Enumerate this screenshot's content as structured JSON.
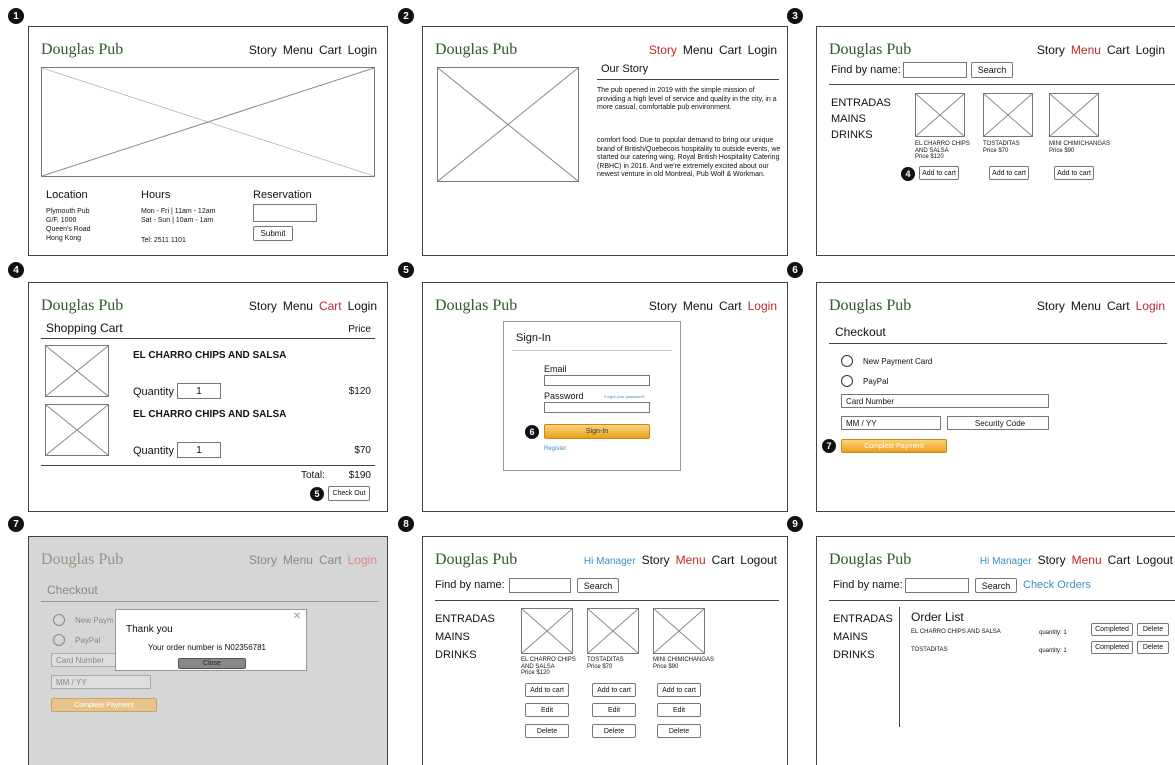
{
  "brand": "Douglas Pub",
  "nav": {
    "story": "Story",
    "menu": "Menu",
    "cart": "Cart",
    "login": "Login",
    "logout": "Logout",
    "hi": "Hi Manager"
  },
  "step_numbers": [
    "1",
    "2",
    "3",
    "4",
    "5",
    "6",
    "7",
    "8",
    "9"
  ],
  "home": {
    "location_title": "Location",
    "location_lines": [
      "Plymouth Pub",
      "G/F, 1000",
      "Queen's Road",
      "Hong Kong"
    ],
    "hours_title": "Hours",
    "hours_lines": [
      "Mon - Fri | 11am - 12am",
      "Sat - Sun | 10am - 1am"
    ],
    "tel": "Tel: 2511 1101",
    "reservation_title": "Reservation",
    "submit_label": "Submit"
  },
  "story": {
    "title": "Our Story",
    "paragraph1": "The pub opened in 2019 with the simple mission of providing a high level of service and quality in the city, in a more casual, comfortable pub environment.",
    "paragraph2": "comfort food. Due to popular demand to bring our unique brand of British/Quebecois hospitality to outside events, we started our catering wing, Royal British Hospitality Catering (RBHC) in 2016. And we're extremely excited about our newest venture in old Montreal, Pub Wolf & Workman."
  },
  "menu": {
    "find_label": "Find by name:",
    "search_label": "Search",
    "check_orders": "Check Orders",
    "categories": [
      "ENTRADAS",
      "MAINS",
      "DRINKS"
    ],
    "items": [
      {
        "name": "EL CHARRO CHIPS AND SALSA",
        "price": "Price $120"
      },
      {
        "name": "TOSTADITAS",
        "price": "Price $70"
      },
      {
        "name": "MINI CHIMICHANGAS",
        "price": "Price $90"
      }
    ],
    "add_to_cart": "Add to cart",
    "edit": "Edit",
    "delete": "Delete",
    "callout": "4"
  },
  "cart": {
    "title": "Shopping Cart",
    "price_header": "Price",
    "items": [
      {
        "name": "EL CHARRO CHIPS AND SALSA",
        "qty_label": "Quantity",
        "qty": "1",
        "price": "$120"
      },
      {
        "name": "EL CHARRO CHIPS AND SALSA",
        "qty_label": "Quantity",
        "qty": "1",
        "price": "$70"
      }
    ],
    "total_label": "Total:",
    "total": "$190",
    "checkout_label": "Check Out",
    "callout": "5"
  },
  "signin": {
    "title": "Sign-In",
    "email_label": "Email",
    "password_label": "Password",
    "forgot": "Forgot your password?",
    "button": "Sign-In",
    "register": "Register",
    "callout": "6"
  },
  "checkout": {
    "title": "Checkout",
    "new_card": "New Payment Card",
    "paypal": "PayPal",
    "card_number": "Card Number",
    "mmyy": "MM / YY",
    "security": "Security Code",
    "complete": "Complete Payment",
    "callout": "7",
    "new_card_truncated": "New Paym"
  },
  "thankyou": {
    "title": "Thank you",
    "message": "Your order number is N02356781",
    "close": "Close",
    "close_icon": "close-icon"
  },
  "orders": {
    "title": "Order List",
    "rows": [
      {
        "name": "EL CHARRO CHIPS AND SALSA",
        "qty": "quantity:  1",
        "completed": "Completed",
        "delete": "Delete"
      },
      {
        "name": "TOSTADITAS",
        "qty": "quantity:  1",
        "completed": "Completed",
        "delete": "Delete"
      }
    ]
  },
  "colors": {
    "brand": "#2f5a2a",
    "active": "#c0282c",
    "accent": "#3a8fc0",
    "orange": "#e9a21c"
  }
}
